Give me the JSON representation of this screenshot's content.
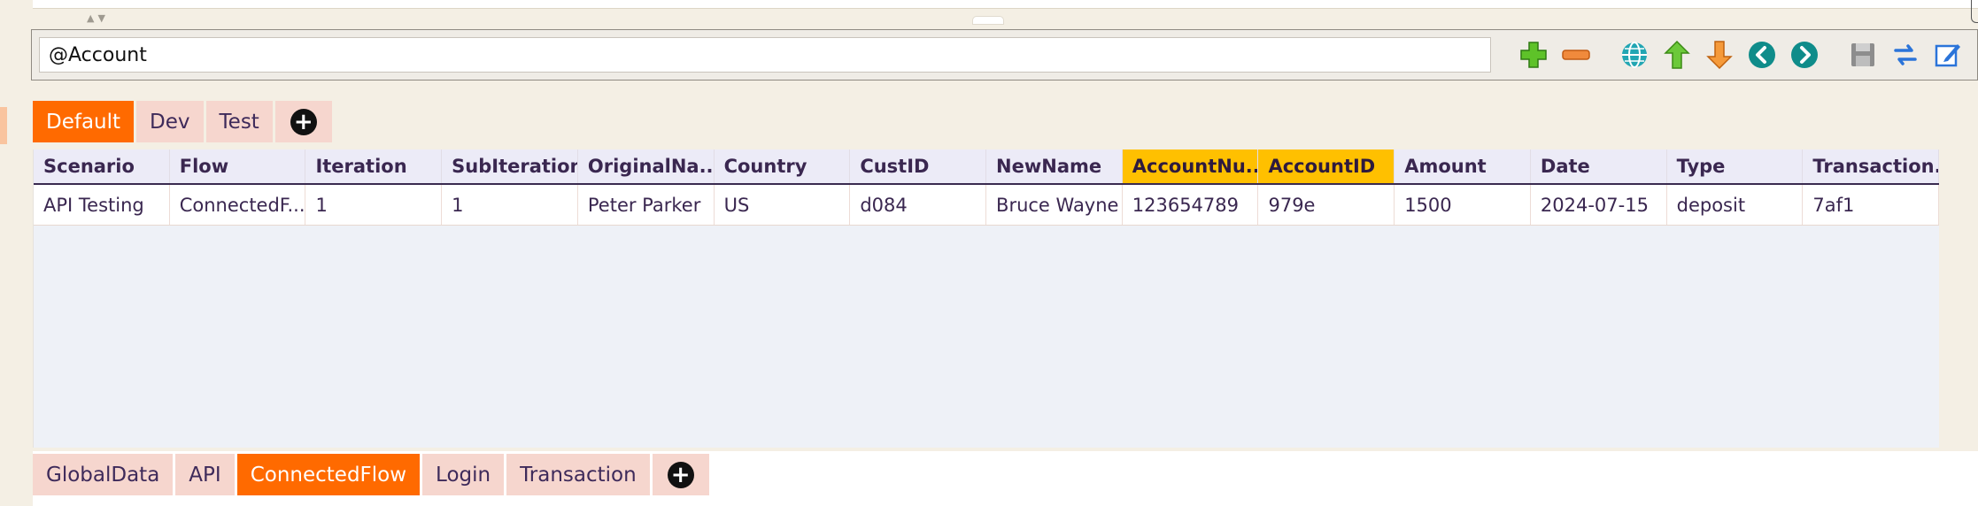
{
  "toolbar": {
    "search_value": "@Account",
    "icons": [
      "add-icon",
      "remove-icon",
      "globe-icon",
      "move-up-icon",
      "move-down-icon",
      "previous-icon",
      "next-icon",
      "save-icon",
      "swap-icon",
      "edit-icon"
    ]
  },
  "env_tabs": [
    {
      "label": "Default",
      "active": true
    },
    {
      "label": "Dev",
      "active": false
    },
    {
      "label": "Test",
      "active": false
    }
  ],
  "table": {
    "columns": [
      "Scenario",
      "Flow",
      "Iteration",
      "SubIteration",
      "OriginalNa...",
      "Country",
      "CustID",
      "NewName",
      "AccountNu...",
      "AccountID",
      "Amount",
      "Date",
      "Type",
      "Transaction..."
    ],
    "highlighted_columns": [
      8,
      9
    ],
    "rows": [
      [
        "API Testing",
        "ConnectedF...",
        "1",
        "1",
        "Peter Parker",
        "US",
        "d084",
        "Bruce Wayne",
        "123654789",
        "979e",
        "1500",
        "2024-07-15",
        "deposit",
        "7af1"
      ]
    ]
  },
  "sheet_tabs": [
    {
      "label": "GlobalData",
      "active": false
    },
    {
      "label": "API",
      "active": false
    },
    {
      "label": "ConnectedFlow",
      "active": true
    },
    {
      "label": "Login",
      "active": false
    },
    {
      "label": "Transaction",
      "active": false
    }
  ],
  "colors": {
    "accent": "#ff6a00",
    "tab_inactive": "#f6d6ce",
    "column_highlight": "#ffc000",
    "text": "#3a2750"
  }
}
